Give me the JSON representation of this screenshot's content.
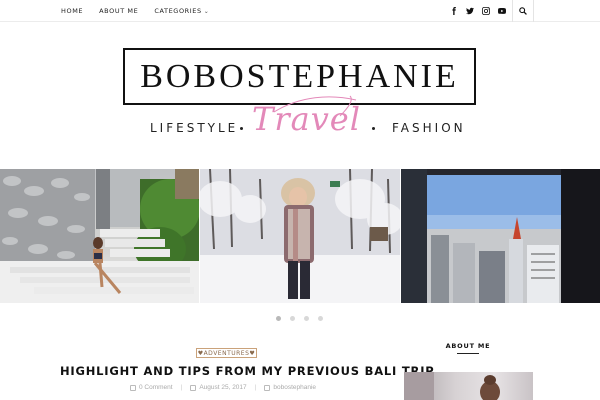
{
  "nav": {
    "items": [
      {
        "label": "HOME"
      },
      {
        "label": "ABOUT ME"
      },
      {
        "label": "CATEGORIES"
      }
    ]
  },
  "social": [
    "facebook-icon",
    "twitter-icon",
    "instagram-icon",
    "youtube-icon"
  ],
  "search_icon": "search-icon",
  "logo": {
    "name": "BOBOSTEPHANIE",
    "script": "Travel",
    "tag_left": "LIFESTYLE",
    "tag_right": "FASHION"
  },
  "slider": {
    "slides": 3,
    "pagination": 4,
    "active_index": 0
  },
  "post": {
    "category": "♥ADVENTURES♥",
    "title": "HIGHLIGHT AND TIPS FROM MY PREVIOUS BALI TRIP",
    "comments": "0 Comment",
    "date": "August 25, 2017",
    "author": "bobostephanie"
  },
  "sidebar": {
    "about_title": "ABOUT ME"
  },
  "colors": {
    "accent_pink": "#e389b9",
    "badge_border": "#caa27a"
  }
}
